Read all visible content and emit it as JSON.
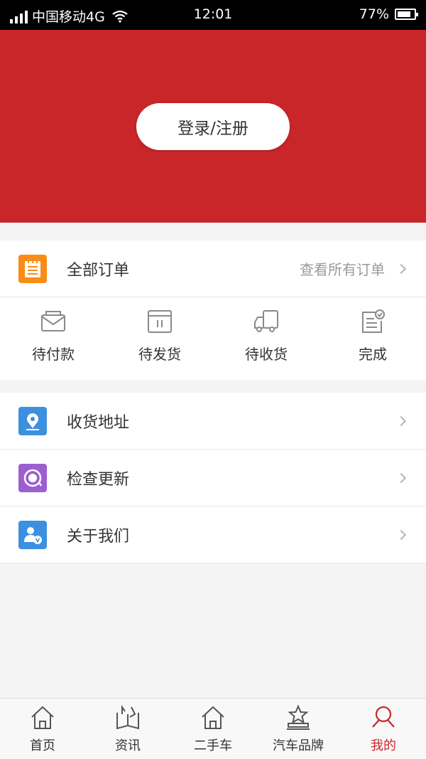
{
  "status_bar": {
    "carrier": "中国移动4G",
    "time": "12:01",
    "battery": "77%",
    "battery_level": 0.77
  },
  "header": {
    "login_label": "登录/注册",
    "bg_color": "#c82628"
  },
  "orders": {
    "title": "全部订单",
    "view_all": "查看所有订单",
    "icon": "order-list-icon",
    "statuses": [
      {
        "label": "待付款",
        "icon": "envelope-icon"
      },
      {
        "label": "待发货",
        "icon": "box-icon"
      },
      {
        "label": "待收货",
        "icon": "truck-icon"
      },
      {
        "label": "完成",
        "icon": "completed-doc-icon"
      }
    ]
  },
  "menu": {
    "items": [
      {
        "label": "收货地址",
        "icon": "location-pin-icon",
        "color": "#3d8fe0"
      },
      {
        "label": "检查更新",
        "icon": "refresh-icon",
        "color": "#9b5fcf"
      },
      {
        "label": "关于我们",
        "icon": "user-v-icon",
        "color": "#3d8fe0"
      }
    ]
  },
  "nav": {
    "items": [
      {
        "label": "首页",
        "icon": "home-icon"
      },
      {
        "label": "资讯",
        "icon": "news-icon"
      },
      {
        "label": "二手车",
        "icon": "used-car-icon"
      },
      {
        "label": "汽车品牌",
        "icon": "brand-star-icon"
      },
      {
        "label": "我的",
        "icon": "profile-icon",
        "active": true
      }
    ],
    "active_color": "#c82628"
  }
}
